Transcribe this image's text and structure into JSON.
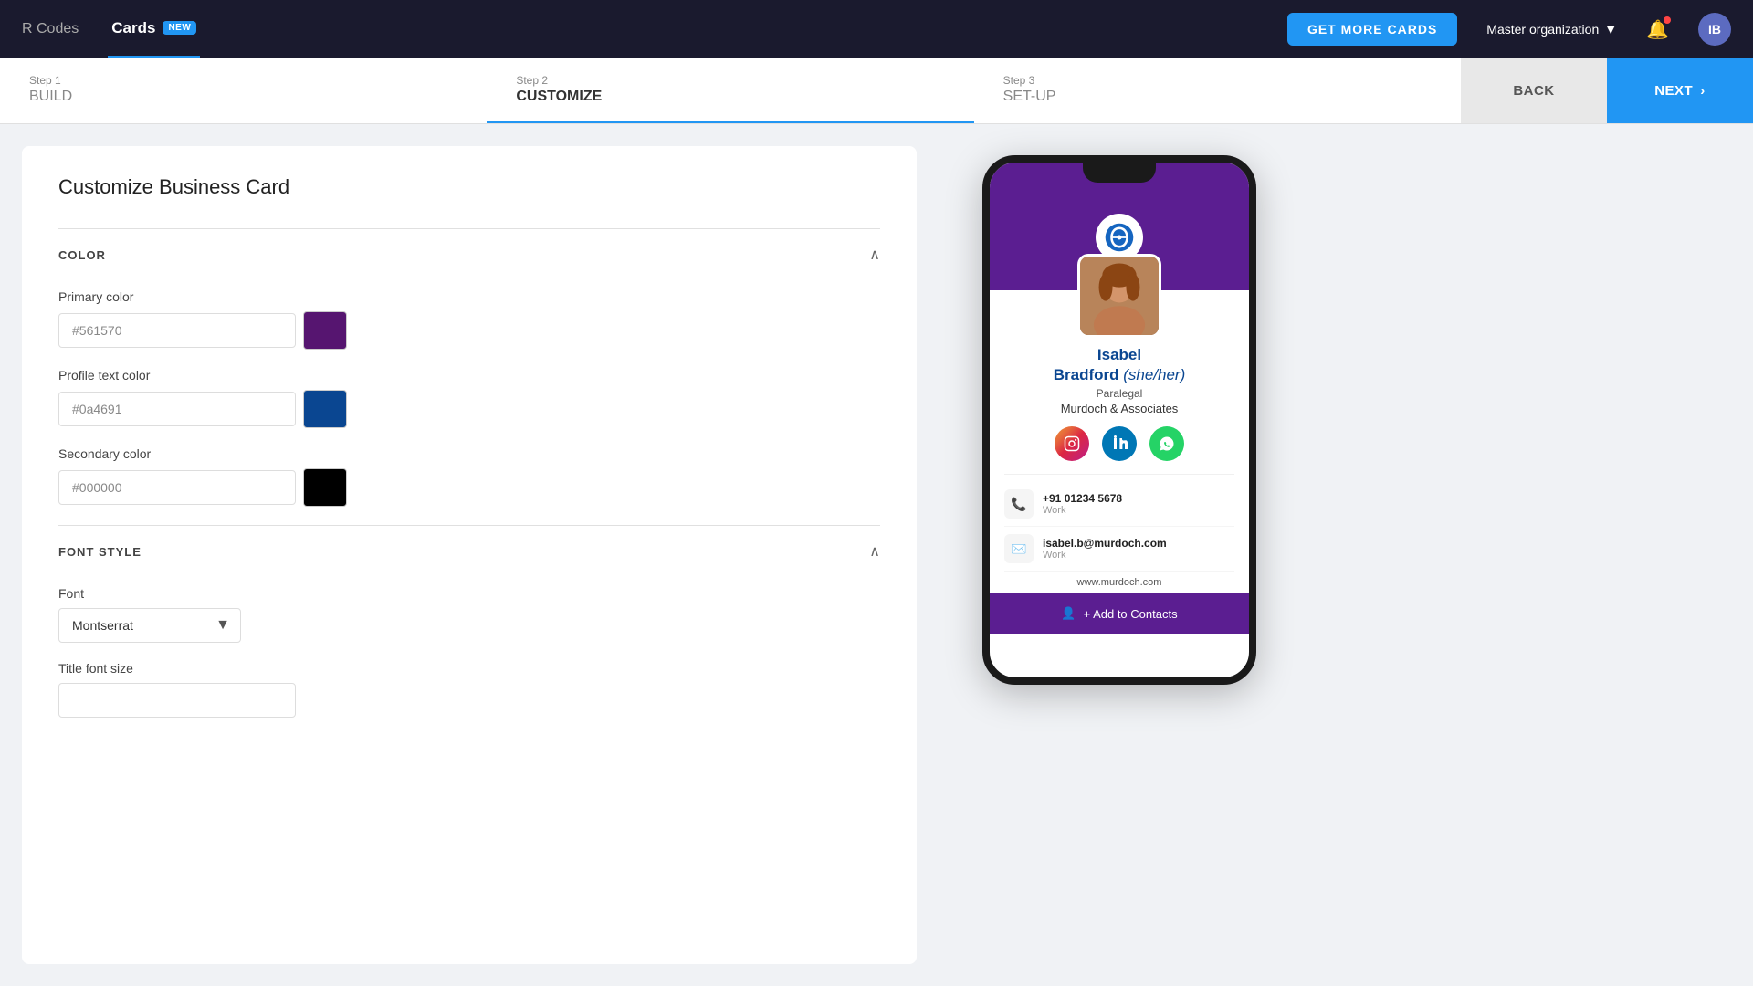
{
  "topnav": {
    "qr_label": "R Codes",
    "cards_label": "Cards",
    "badge_label": "NEW",
    "get_more_label": "GET MORE CARDS",
    "org_label": "Master organization",
    "avatar_initials": "IB"
  },
  "stepbar": {
    "step1_number": "Step 1",
    "step1_label": "BUILD",
    "step2_number": "Step 2",
    "step2_label": "CUSTOMIZE",
    "step3_number": "Step 3",
    "step3_label": "SET-UP",
    "back_label": "BACK",
    "next_label": "NEXT"
  },
  "customize": {
    "title": "Customize Business Card",
    "color_section": "COLOR",
    "primary_color_label": "Primary color",
    "primary_color_value": "#561570",
    "primary_color_hex": "#561570",
    "profile_text_color_label": "Profile text color",
    "profile_text_color_value": "#0a4691",
    "profile_text_color_hex": "#0a4691",
    "secondary_color_label": "Secondary color",
    "secondary_color_value": "#000000",
    "secondary_color_hex": "#000000",
    "font_section": "FONT STYLE",
    "font_label": "Font",
    "font_value": "Montserrat",
    "title_font_size_label": "Title font size"
  },
  "card_preview": {
    "name_first": "Isabel",
    "name_last": "Bradford",
    "pronouns": "(she/her)",
    "title": "Paralegal",
    "company": "Murdoch & Associates",
    "phone": "+91 01234 5678",
    "phone_type": "Work",
    "email": "isabel.b@murdoch.com",
    "email_type": "Work",
    "website": "www.murdoch.com",
    "add_contacts_label": "+ Add to Contacts"
  }
}
